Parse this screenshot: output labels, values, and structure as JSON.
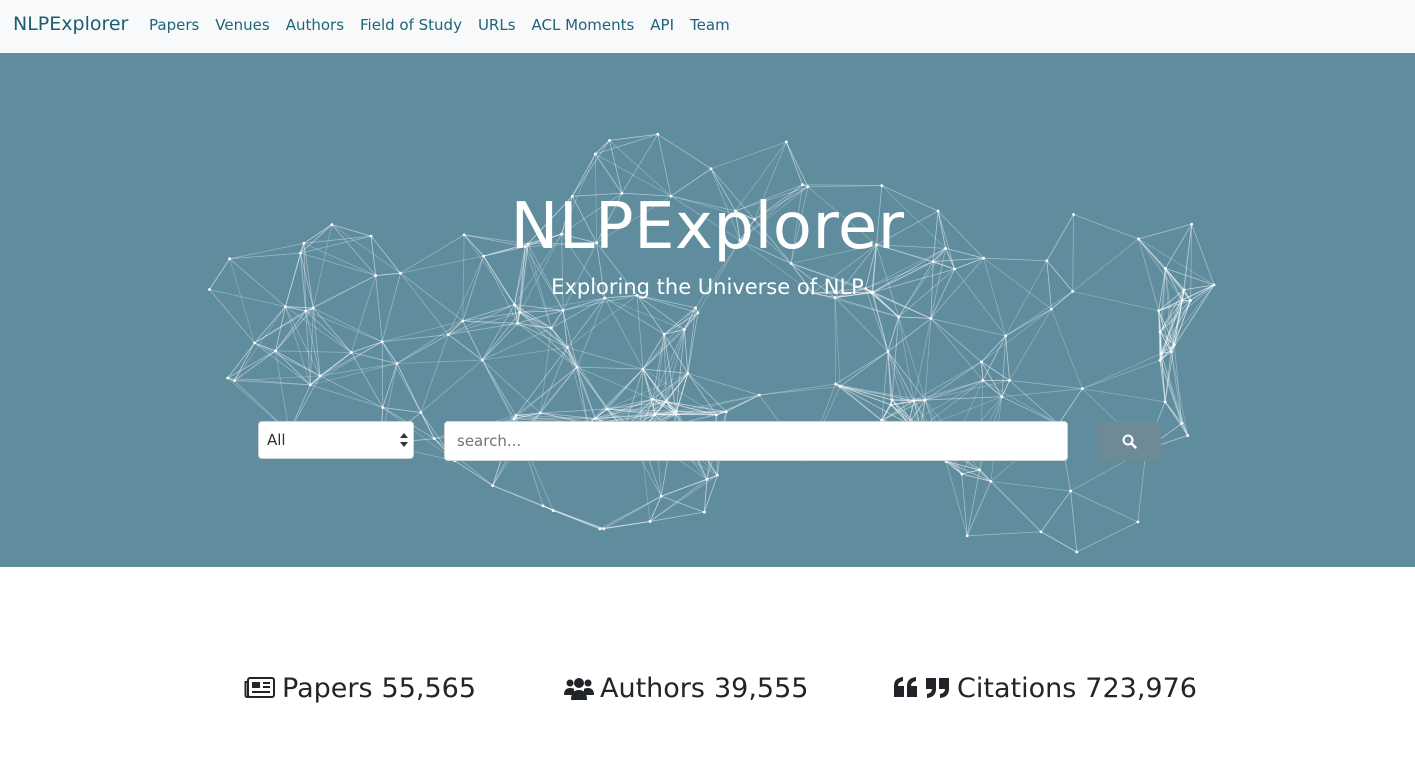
{
  "navbar": {
    "brand": "NLPExplorer",
    "links": [
      "Papers",
      "Venues",
      "Authors",
      "Field of Study",
      "URLs",
      "ACL Moments",
      "API",
      "Team"
    ]
  },
  "hero": {
    "title": "NLPExplorer",
    "subtitle": "Exploring the Universe of NLP",
    "background_color": "#5f8d9e"
  },
  "search": {
    "category_selected": "All",
    "placeholder": "search...",
    "button_icon": "search-icon"
  },
  "stats": [
    {
      "icon": "newspaper-icon",
      "label": "Papers",
      "value": "55,565"
    },
    {
      "icon": "users-icon",
      "label": "Authors",
      "value": "39,555"
    },
    {
      "icon": "quote-icon",
      "label": "Citations",
      "value": "723,976"
    }
  ],
  "colors": {
    "brand": "#1b5e6e",
    "nav_background": "#f8f9fa",
    "search_button": "#6d8a96"
  }
}
